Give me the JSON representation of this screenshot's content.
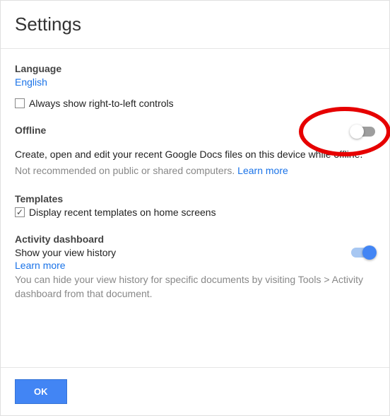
{
  "header": {
    "title": "Settings"
  },
  "language": {
    "label": "Language",
    "value": "English",
    "rtl_checkbox_label": "Always show right-to-left controls",
    "rtl_checked": false
  },
  "offline": {
    "label": "Offline",
    "toggle_on": false,
    "description": "Create, open and edit your recent Google Docs files on this device while offline.",
    "note": "Not recommended on public or shared computers.",
    "learn_more": "Learn more"
  },
  "templates": {
    "label": "Templates",
    "checkbox_label": "Display recent templates on home screens",
    "checked": true
  },
  "activity": {
    "label": "Activity dashboard",
    "subtitle": "Show your view history",
    "toggle_on": true,
    "learn_more": "Learn more",
    "note": "You can hide your view history for specific documents by visiting Tools > Activity dashboard from that document."
  },
  "footer": {
    "ok": "OK"
  }
}
